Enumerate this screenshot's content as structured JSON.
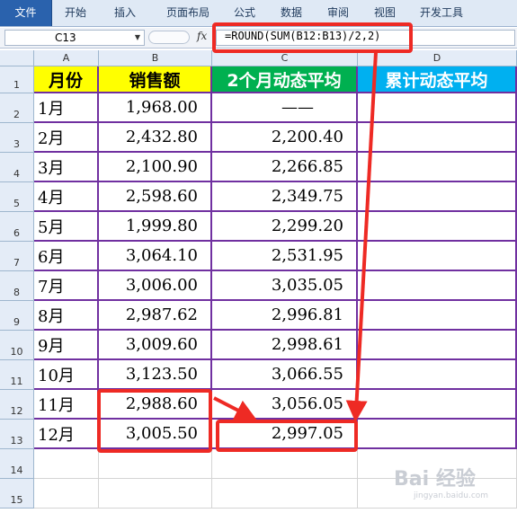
{
  "ribbon": {
    "tabs": [
      "文件",
      "开始",
      "插入",
      "页面布局",
      "公式",
      "数据",
      "审阅",
      "视图",
      "开发工具"
    ]
  },
  "formula_bar": {
    "name_box": "C13",
    "fx_label": "fx",
    "formula": "=ROUND(SUM(B12:B13)/2,2)"
  },
  "sheet": {
    "columns": [
      "A",
      "B",
      "C",
      "D"
    ],
    "rows": [
      "1",
      "2",
      "3",
      "4",
      "5",
      "6",
      "7",
      "8",
      "9",
      "10",
      "11",
      "12",
      "13",
      "14",
      "15"
    ],
    "headers": [
      "月份",
      "销售额",
      "2个月动态平均",
      "累计动态平均"
    ],
    "data": [
      [
        "1月",
        "1,968.00",
        "——"
      ],
      [
        "2月",
        "2,432.80",
        "2,200.40"
      ],
      [
        "3月",
        "2,100.90",
        "2,266.85"
      ],
      [
        "4月",
        "2,598.60",
        "2,349.75"
      ],
      [
        "5月",
        "1,999.80",
        "2,299.20"
      ],
      [
        "6月",
        "3,064.10",
        "2,531.95"
      ],
      [
        "7月",
        "3,006.00",
        "3,035.05"
      ],
      [
        "8月",
        "2,987.62",
        "2,996.81"
      ],
      [
        "9月",
        "3,009.60",
        "2,998.61"
      ],
      [
        "10月",
        "3,123.50",
        "3,066.55"
      ],
      [
        "11月",
        "2,988.60",
        "3,056.05"
      ],
      [
        "12月",
        "3,005.50",
        "2,997.05"
      ]
    ]
  },
  "colors": {
    "header_month": "#ffff00",
    "header_sales": "#ffff00",
    "header_avg2": "#00b050",
    "header_cumavg": "#00b0f0",
    "grid_border": "#7030a0",
    "highlight": "#ee2a24"
  },
  "watermark": {
    "text": "Bai 经验",
    "sub": "jingyan.baidu.com"
  }
}
